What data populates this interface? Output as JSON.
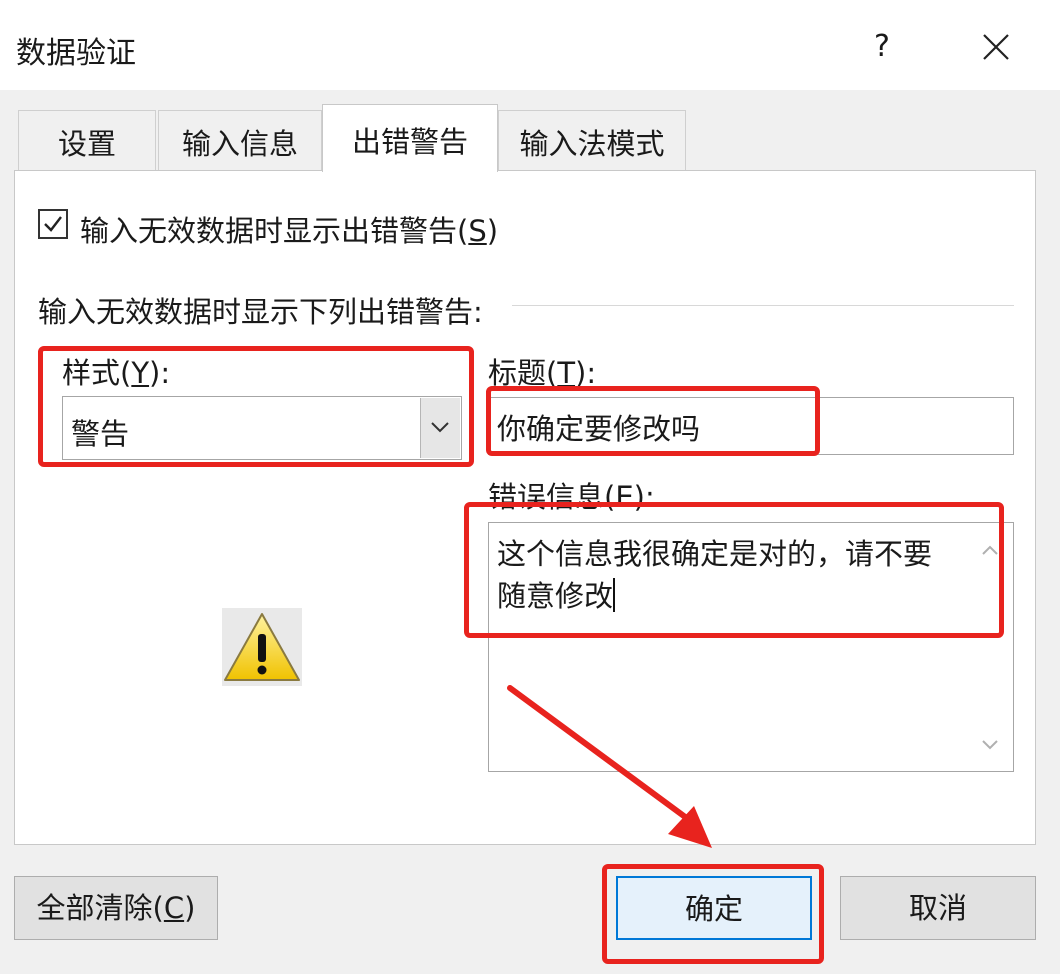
{
  "window": {
    "title": "数据验证",
    "help_label": "?"
  },
  "tabs": [
    {
      "label": "设置"
    },
    {
      "label": "输入信息"
    },
    {
      "label": "出错警告",
      "active": true
    },
    {
      "label": "输入法模式"
    }
  ],
  "show_alert": {
    "label": "输入无效数据时显示出错警告(",
    "key": "S",
    "suffix": ")",
    "checked": true
  },
  "group_label": "输入无效数据时显示下列出错警告:",
  "style": {
    "label": "样式(",
    "key": "Y",
    "suffix": "):",
    "value": "警告",
    "icon": "warning-triangle-icon"
  },
  "title_field": {
    "label": "标题(",
    "key": "T",
    "suffix": "):",
    "value": "你确定要修改吗"
  },
  "error_message": {
    "label": "错误信息(E):",
    "value": "这个信息我很确定是对的，请不要\n随意修改"
  },
  "buttons": {
    "clear_all": {
      "label": "全部清除(",
      "key": "C",
      "suffix": ")"
    },
    "ok": "确定",
    "cancel": "取消"
  },
  "annotation_color": "#e8231e",
  "accent_color": "#0078d7"
}
